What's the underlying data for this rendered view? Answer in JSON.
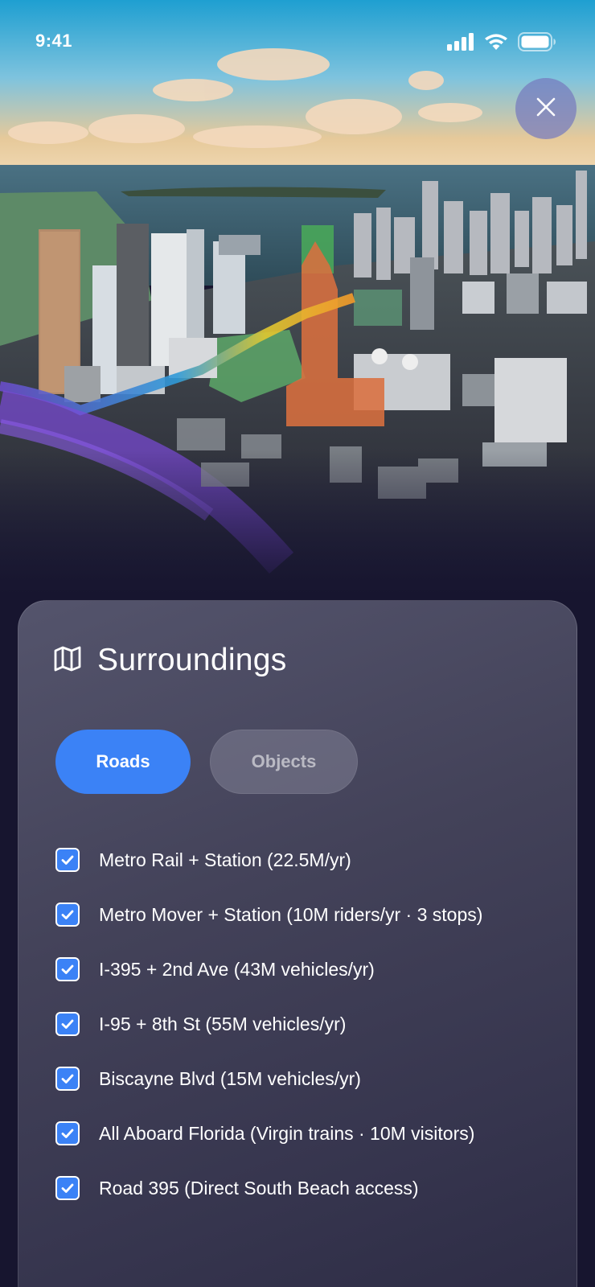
{
  "status_bar": {
    "time": "9:41",
    "icons": [
      "cellular-signal-icon",
      "wifi-icon",
      "battery-icon"
    ]
  },
  "hero": {
    "description_icon": "aerial-city-view",
    "highlight_color": "#d9703f"
  },
  "close_button": {
    "icon": "close-icon"
  },
  "panel": {
    "icon": "map-icon",
    "title": "Surroundings",
    "tabs": [
      {
        "label": "Roads",
        "active": true
      },
      {
        "label": "Objects",
        "active": false
      }
    ],
    "items": [
      {
        "label": "Metro Rail + Station (22.5M/yr)",
        "checked": true
      },
      {
        "label": "Metro Mover + Station (10M riders/yr · 3 stops)",
        "checked": true
      },
      {
        "label": "I-395 + 2nd Ave (43M vehicles/yr)",
        "checked": true
      },
      {
        "label": "I-95 + 8th St (55M vehicles/yr)",
        "checked": true
      },
      {
        "label": "Biscayne Blvd (15M vehicles/yr)",
        "checked": true
      },
      {
        "label": "All Aboard Florida (Virgin trains · 10M visitors)",
        "checked": true
      },
      {
        "label": "Road 395 (Direct South Beach access)",
        "checked": true
      }
    ]
  },
  "colors": {
    "accent": "#3b82f6",
    "background": "#17152f",
    "panel": "#43425a"
  }
}
